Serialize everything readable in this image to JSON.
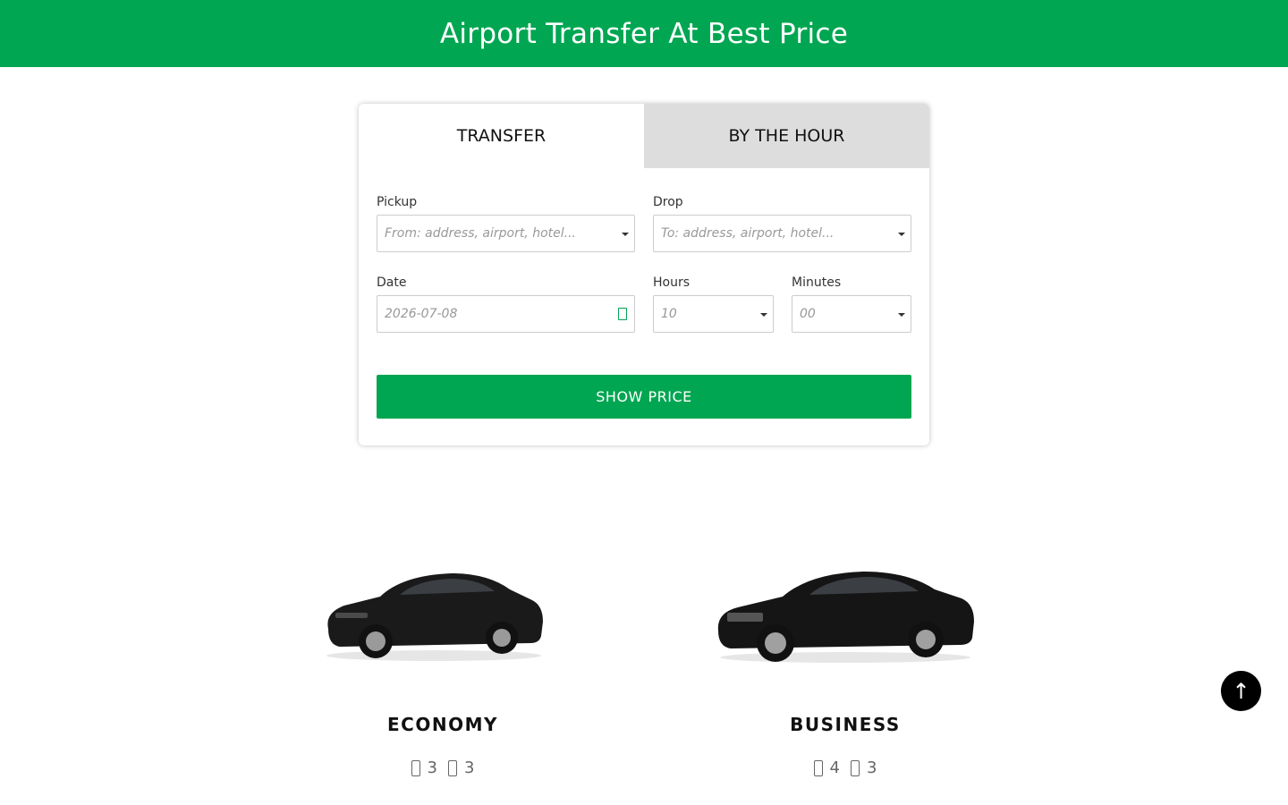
{
  "header": {
    "title": "Airport Transfer At Best Price"
  },
  "tabs": [
    {
      "label": "TRANSFER",
      "active": true
    },
    {
      "label": "BY THE HOUR",
      "active": false
    }
  ],
  "form": {
    "pickup": {
      "label": "Pickup",
      "placeholder": "From: address, airport, hotel..."
    },
    "drop": {
      "label": "Drop",
      "placeholder": "To: address, airport, hotel..."
    },
    "date": {
      "label": "Date",
      "placeholder": "2026-07-08"
    },
    "hours": {
      "label": "Hours",
      "value": "10"
    },
    "minutes": {
      "label": "Minutes",
      "value": "00"
    },
    "submit_label": "SHOW PRICE"
  },
  "vehicles": [
    {
      "name": "ECONOMY",
      "passengers": "3",
      "luggage": "3",
      "color": "#1a1a1a"
    },
    {
      "name": "BUSINESS",
      "passengers": "4",
      "luggage": "3",
      "color": "#151515"
    }
  ],
  "scroll_top": {
    "icon": "arrow-up-icon",
    "glyph": "↑"
  },
  "colors": {
    "brand": "#00a651",
    "tab_inactive": "#dddddd"
  }
}
